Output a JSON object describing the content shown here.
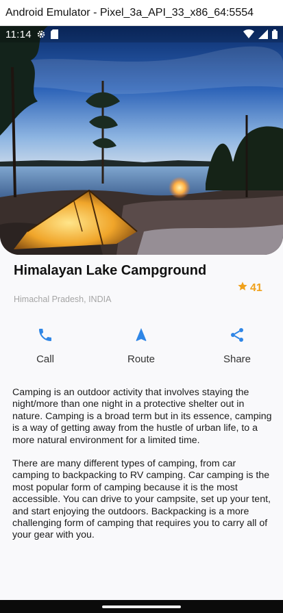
{
  "window": {
    "title": "Android Emulator - Pixel_3a_API_33_x86_64:5554"
  },
  "status_bar": {
    "time": "11:14"
  },
  "place": {
    "title": "Himalayan Lake Campground",
    "location": "Himachal Pradesh, INDIA",
    "rating": "41"
  },
  "actions": [
    {
      "label": "Call"
    },
    {
      "label": "Route"
    },
    {
      "label": "Share"
    }
  ],
  "description": {
    "paragraphs": [
      "Camping is an outdoor activity that involves staying the night/more than one night in a protective shelter out in nature. Camping is a broad term but in its essence, camping is a way of getting away from the hustle of urban life, to a more natural environment for a limited time.",
      "There are many different types of camping, from car camping to backpacking to RV camping. Car camping is the most popular form of camping because it is the most accessible. You can drive to your campsite, set up your tent, and start enjoying the outdoors. Backpacking is a more challenging form of camping that requires you to carry all of your gear with you."
    ]
  },
  "colors": {
    "accent": "#2f86e6",
    "star": "#f0a11b",
    "title": "#111111",
    "secondary_text": "#a5a5a5"
  },
  "icons": {
    "status": [
      "gear-icon",
      "sd-card-icon",
      "wifi-icon",
      "signal-icon",
      "battery-icon"
    ],
    "actions": [
      "phone-icon",
      "navigation-icon",
      "share-icon"
    ],
    "rating": "star-icon"
  }
}
